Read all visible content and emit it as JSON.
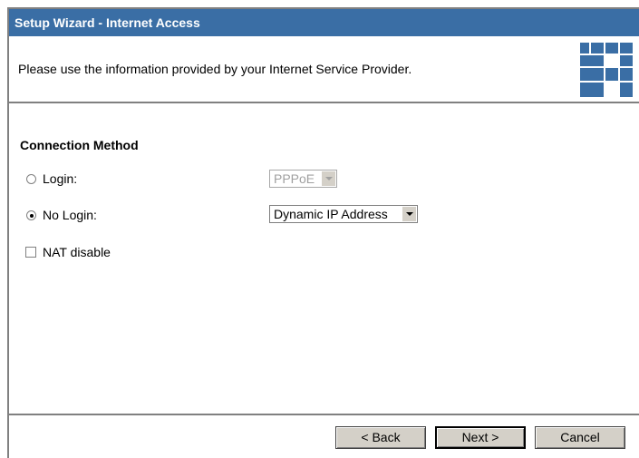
{
  "window": {
    "title": "Setup Wizard - Internet Access"
  },
  "banner": {
    "text": "Please use the information provided by your Internet Service Provider."
  },
  "connection": {
    "section_title": "Connection Method",
    "login": {
      "label": "Login:",
      "selected": false,
      "select_value": "PPPoE",
      "select_enabled": false
    },
    "no_login": {
      "label": "No Login:",
      "selected": true,
      "select_value": "Dynamic IP Address",
      "select_enabled": true
    },
    "nat": {
      "label": "NAT disable",
      "checked": false
    }
  },
  "buttons": {
    "back": "< Back",
    "next": "Next >",
    "cancel": "Cancel"
  },
  "colors": {
    "titlebar": "#3a6ea5",
    "button_face": "#d4d0c8",
    "logo": "#3a6ea5"
  }
}
